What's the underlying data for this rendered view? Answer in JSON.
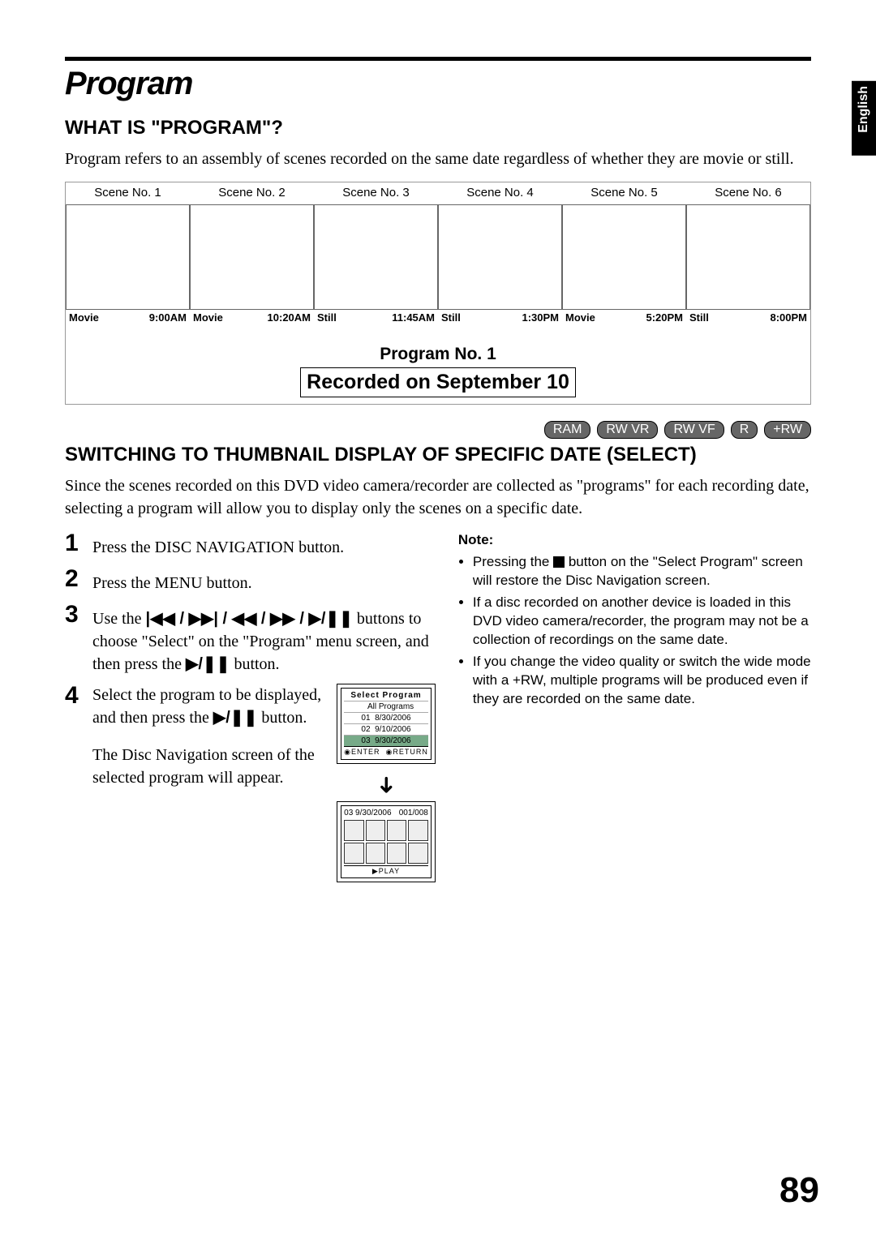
{
  "language_tab": "English",
  "page_title": "Program",
  "section1": {
    "heading": "WHAT IS \"PROGRAM\"?",
    "body": "Program refers to an assembly of scenes recorded on the same date regardless of whether they are movie or still."
  },
  "diagram": {
    "scenes": [
      "Scene No. 1",
      "Scene No. 2",
      "Scene No. 3",
      "Scene No. 4",
      "Scene No. 5",
      "Scene No. 6"
    ],
    "times": [
      {
        "type": "Movie",
        "time": "9:00AM"
      },
      {
        "type": "Movie",
        "time": "10:20AM"
      },
      {
        "type": "Still",
        "time": "11:45AM"
      },
      {
        "type": "Still",
        "time": "1:30PM"
      },
      {
        "type": "Movie",
        "time": "5:20PM"
      },
      {
        "type": "Still",
        "time": "8:00PM"
      }
    ],
    "program_label": "Program No. 1",
    "recorded_label": "Recorded on September 10"
  },
  "badges": [
    "RAM",
    "RW VR",
    "RW VF",
    "R",
    "+RW"
  ],
  "section2": {
    "heading": "SWITCHING TO THUMBNAIL DISPLAY OF SPECIFIC DATE (SELECT)",
    "body": "Since the scenes recorded on this DVD video camera/recorder are collected as \"programs\" for each recording date, selecting a program will allow you to display only the scenes on a specific date."
  },
  "steps": {
    "s1": "Press the DISC NAVIGATION button.",
    "s2": "Press the MENU button.",
    "s3_a": "Use the ",
    "s3_glyphs": "|◀◀ / ▶▶| / ◀◀ / ▶▶ / ▶/❚❚",
    "s3_b": " buttons to choose \"Select\" on the \"Program\" menu screen, and then press the ",
    "s3_glyph2": "▶/❚❚",
    "s3_c": " button.",
    "s4_a": "Select the program to be displayed, and then press the ",
    "s4_glyph": "▶/❚❚",
    "s4_b": " button.",
    "s4_follow": "The Disc Navigation screen of the selected program will appear."
  },
  "screens": {
    "select_title": "Select Program",
    "all": "All Programs",
    "rows": [
      {
        "n": "01",
        "d": "8/30/2006"
      },
      {
        "n": "02",
        "d": "9/10/2006"
      },
      {
        "n": "03",
        "d": "9/30/2006"
      }
    ],
    "foot1_a": "ENTER",
    "foot1_b": "RETURN",
    "nav_header_left": "03  9/30/2006",
    "nav_header_right": "001/008",
    "nav_foot": "PLAY"
  },
  "note": {
    "heading": "Note:",
    "items_pre1": "Pressing the ",
    "items_post1": " button on the \"Select Program\" screen will restore the Disc Navigation screen.",
    "item2": "If a disc recorded on another device is loaded in this DVD video camera/recorder, the program may not be a collection of recordings on the same date.",
    "item3": "If you change the video quality or switch the wide mode with a +RW, multiple programs will be produced even if they are recorded on the same date."
  },
  "page_number": "89"
}
